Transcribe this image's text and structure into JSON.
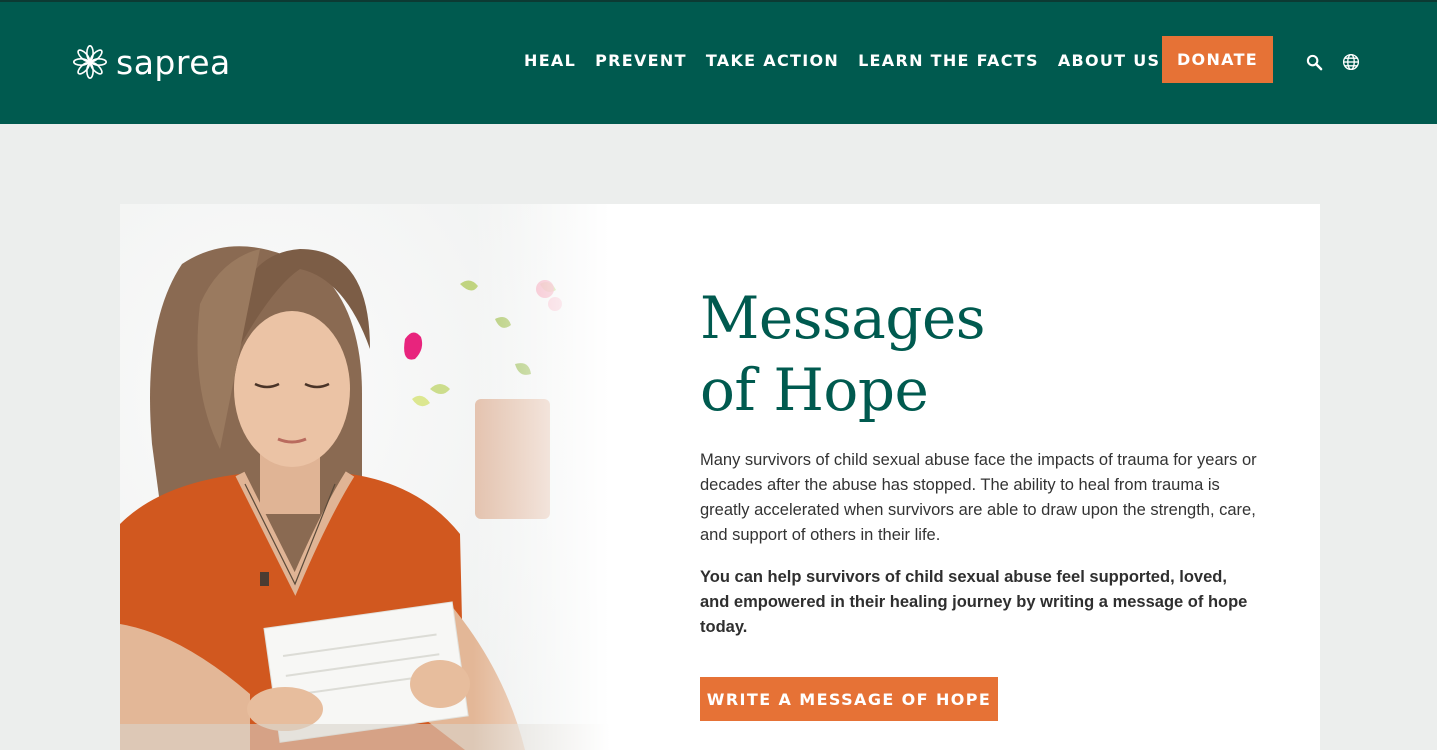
{
  "brand": {
    "name": "saprea",
    "logo_icon": "star-flower-icon"
  },
  "nav": {
    "items": [
      {
        "label": "HEAL"
      },
      {
        "label": "PREVENT"
      },
      {
        "label": "TAKE ACTION"
      },
      {
        "label": "LEARN THE FACTS"
      },
      {
        "label": "ABOUT US"
      }
    ],
    "donate_label": "DONATE",
    "search_icon": "search-icon",
    "language_icon": "globe-icon"
  },
  "hero": {
    "title_line1": "Messages",
    "title_line2": "of Hope",
    "intro": "Many survivors of child sexual abuse face the impacts of trauma for years or decades after the abuse has stopped. The ability to heal from trauma is greatly accelerated when survivors are able to draw upon the strength, care, and support of others in their life.",
    "emphasis": "You can help survivors of child sexual abuse feel supported, loved, and empowered in their healing journey by writing a message of hope today.",
    "cta_label": "WRITE A MESSAGE OF HOPE"
  },
  "colors": {
    "header_bg": "#005a4f",
    "accent": "#e67236",
    "page_bg": "#eceeed",
    "title": "#005a4f"
  }
}
